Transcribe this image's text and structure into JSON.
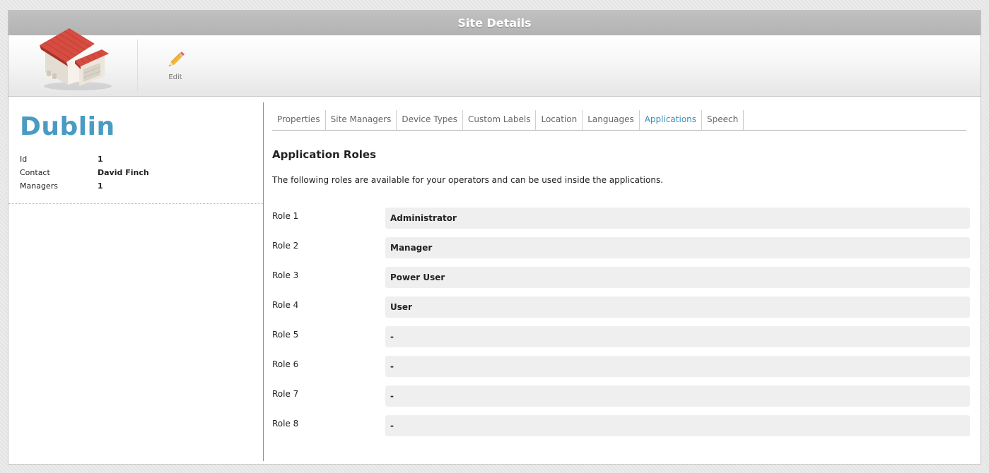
{
  "window": {
    "title": "Site Details"
  },
  "toolbar": {
    "edit_label": "Edit",
    "logo_icon": "warehouse-building-icon",
    "edit_icon": "pencil-icon"
  },
  "site": {
    "name": "Dublin",
    "info": [
      {
        "label": "Id",
        "value": "1"
      },
      {
        "label": "Contact",
        "value": "David Finch"
      },
      {
        "label": "Managers",
        "value": "1"
      }
    ]
  },
  "tabs": [
    {
      "label": "Properties"
    },
    {
      "label": "Site Managers"
    },
    {
      "label": "Device Types"
    },
    {
      "label": "Custom Labels"
    },
    {
      "label": "Location"
    },
    {
      "label": "Languages"
    },
    {
      "label": "Applications",
      "active": true
    },
    {
      "label": "Speech"
    }
  ],
  "main": {
    "title": "Application Roles",
    "description": "The following roles are available for your operators and can be used inside the applications.",
    "roles": [
      {
        "label": "Role 1",
        "value": "Administrator"
      },
      {
        "label": "Role 2",
        "value": "Manager"
      },
      {
        "label": "Role 3",
        "value": "Power User"
      },
      {
        "label": "Role 4",
        "value": "User"
      },
      {
        "label": "Role 5",
        "value": "-"
      },
      {
        "label": "Role 6",
        "value": "-"
      },
      {
        "label": "Role 7",
        "value": "-"
      },
      {
        "label": "Role 8",
        "value": "-"
      }
    ]
  },
  "colors": {
    "accent": "#4a9bc2",
    "active_tab": "#3b90bb",
    "titlebar": "#b8b8b8",
    "field_bg": "#efefef"
  }
}
